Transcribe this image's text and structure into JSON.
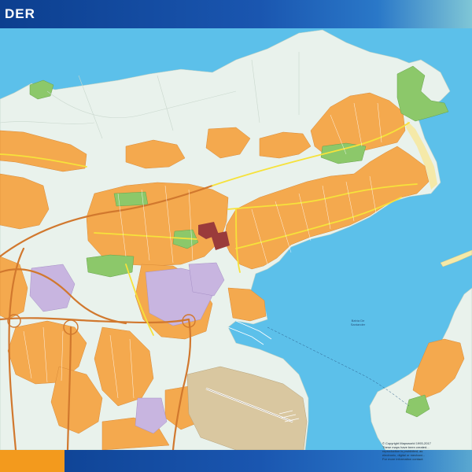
{
  "header": {
    "title": "DER"
  },
  "map": {
    "bay_label_line1": "Bahía De",
    "bay_label_line2": "Santander",
    "colors": {
      "sea": "#5cc0ea",
      "land": "#e9f2ec",
      "urban": "#f4a94e",
      "industrial": "#c8b5e0",
      "park": "#8cc86a",
      "beach": "#f5e9a8",
      "airport": "#d9c7a0",
      "highway": "#d1782e",
      "main_road": "#f6e23b"
    }
  },
  "footer": {
    "copyright_lines": [
      "© Copyright Mapsworld 1993-2017",
      "These maps have been created...",
      "reproduction is prohibited, as",
      "electronic, digital or mechani...",
      "For more information contact:"
    ]
  }
}
